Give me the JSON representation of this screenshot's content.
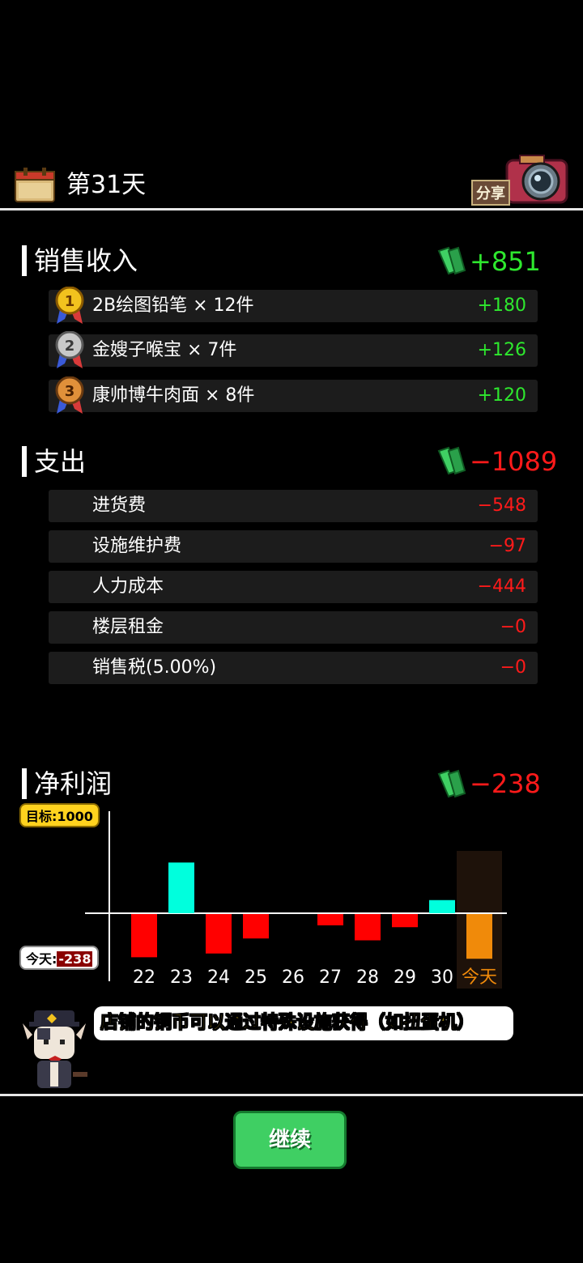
{
  "header": {
    "day_title": "第31天",
    "share_label": "分享"
  },
  "income": {
    "title": "销售收入",
    "total": "+851",
    "items": [
      {
        "rank": "1",
        "label": "2B绘图铅笔 × 12件",
        "value": "+180"
      },
      {
        "rank": "2",
        "label": "金嫂子喉宝 × 7件",
        "value": "+126"
      },
      {
        "rank": "3",
        "label": "康帅博牛肉面 × 8件",
        "value": "+120"
      }
    ]
  },
  "expense": {
    "title": "支出",
    "total": "−1089",
    "items": [
      {
        "label": "进货费",
        "value": "−548"
      },
      {
        "label": "设施维护费",
        "value": "−97"
      },
      {
        "label": "人力成本",
        "value": "−444"
      },
      {
        "label": "楼层租金",
        "value": "−0"
      },
      {
        "label": "销售税(5.00%)",
        "value": "−0"
      }
    ]
  },
  "profit": {
    "title": "净利润",
    "total": "−238",
    "target_label": "目标:1000",
    "today_label": "今天:",
    "today_value": "-238"
  },
  "chart_data": {
    "type": "bar",
    "categories": [
      "22",
      "23",
      "24",
      "25",
      "26",
      "27",
      "28",
      "29",
      "30",
      "今天"
    ],
    "values": [
      -230,
      270,
      -210,
      -130,
      0,
      -60,
      -140,
      -70,
      70,
      -238
    ],
    "colors": {
      "positive": "#00ffdd",
      "negative": "#ff0000",
      "today": "#f08a0a",
      "today_bg": "#1e120a"
    }
  },
  "tip": {
    "text": "店铺的铜币可以通过特殊设施获得（如扭蛋机）"
  },
  "continue_label": "继续",
  "colors": {
    "positive": "#2ee82e",
    "negative": "#ff1a1a",
    "accent_yellow": "#ffd21e"
  }
}
